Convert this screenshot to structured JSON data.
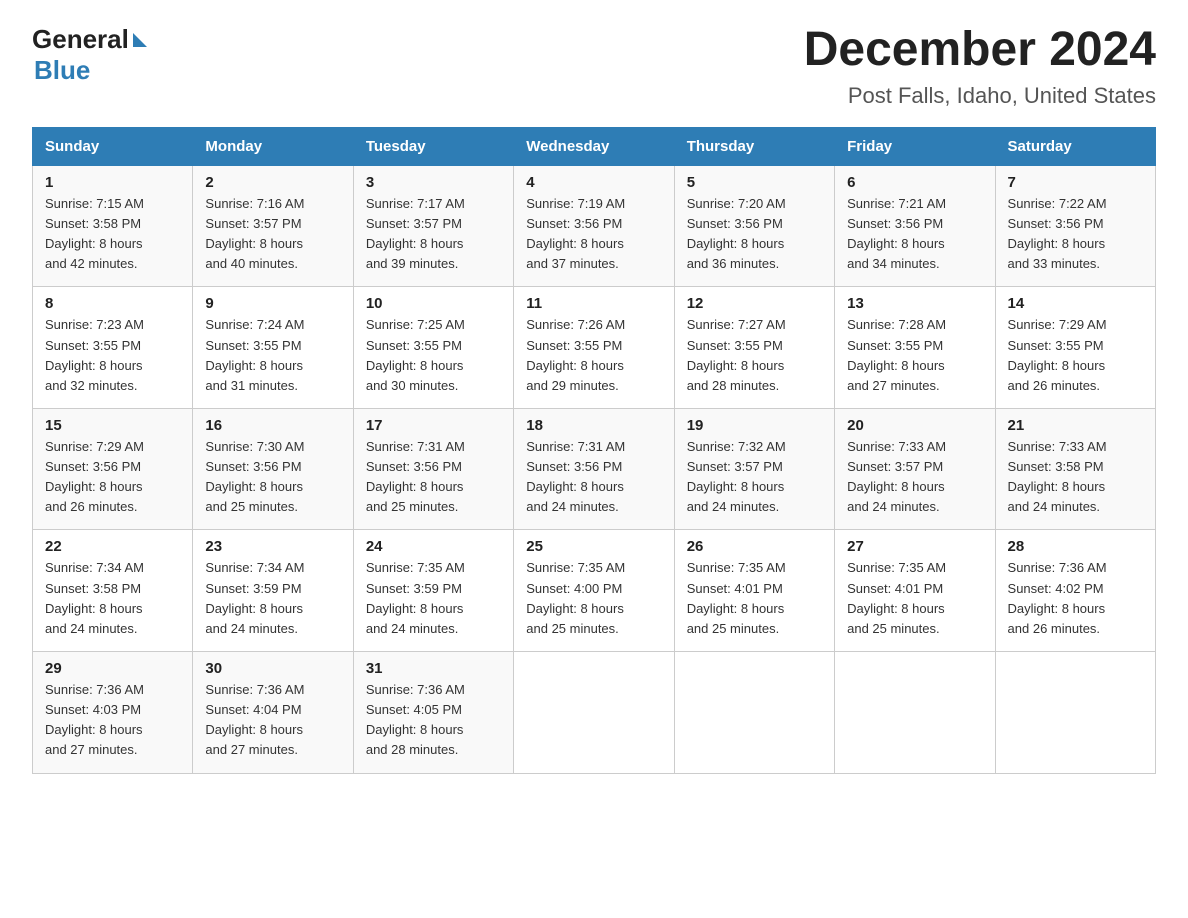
{
  "header": {
    "logo_line1": "General",
    "logo_line2": "Blue",
    "title": "December 2024",
    "subtitle": "Post Falls, Idaho, United States"
  },
  "calendar": {
    "days_of_week": [
      "Sunday",
      "Monday",
      "Tuesday",
      "Wednesday",
      "Thursday",
      "Friday",
      "Saturday"
    ],
    "weeks": [
      [
        {
          "date": "1",
          "sunrise": "7:15 AM",
          "sunset": "3:58 PM",
          "daylight": "8 hours and 42 minutes."
        },
        {
          "date": "2",
          "sunrise": "7:16 AM",
          "sunset": "3:57 PM",
          "daylight": "8 hours and 40 minutes."
        },
        {
          "date": "3",
          "sunrise": "7:17 AM",
          "sunset": "3:57 PM",
          "daylight": "8 hours and 39 minutes."
        },
        {
          "date": "4",
          "sunrise": "7:19 AM",
          "sunset": "3:56 PM",
          "daylight": "8 hours and 37 minutes."
        },
        {
          "date": "5",
          "sunrise": "7:20 AM",
          "sunset": "3:56 PM",
          "daylight": "8 hours and 36 minutes."
        },
        {
          "date": "6",
          "sunrise": "7:21 AM",
          "sunset": "3:56 PM",
          "daylight": "8 hours and 34 minutes."
        },
        {
          "date": "7",
          "sunrise": "7:22 AM",
          "sunset": "3:56 PM",
          "daylight": "8 hours and 33 minutes."
        }
      ],
      [
        {
          "date": "8",
          "sunrise": "7:23 AM",
          "sunset": "3:55 PM",
          "daylight": "8 hours and 32 minutes."
        },
        {
          "date": "9",
          "sunrise": "7:24 AM",
          "sunset": "3:55 PM",
          "daylight": "8 hours and 31 minutes."
        },
        {
          "date": "10",
          "sunrise": "7:25 AM",
          "sunset": "3:55 PM",
          "daylight": "8 hours and 30 minutes."
        },
        {
          "date": "11",
          "sunrise": "7:26 AM",
          "sunset": "3:55 PM",
          "daylight": "8 hours and 29 minutes."
        },
        {
          "date": "12",
          "sunrise": "7:27 AM",
          "sunset": "3:55 PM",
          "daylight": "8 hours and 28 minutes."
        },
        {
          "date": "13",
          "sunrise": "7:28 AM",
          "sunset": "3:55 PM",
          "daylight": "8 hours and 27 minutes."
        },
        {
          "date": "14",
          "sunrise": "7:29 AM",
          "sunset": "3:55 PM",
          "daylight": "8 hours and 26 minutes."
        }
      ],
      [
        {
          "date": "15",
          "sunrise": "7:29 AM",
          "sunset": "3:56 PM",
          "daylight": "8 hours and 26 minutes."
        },
        {
          "date": "16",
          "sunrise": "7:30 AM",
          "sunset": "3:56 PM",
          "daylight": "8 hours and 25 minutes."
        },
        {
          "date": "17",
          "sunrise": "7:31 AM",
          "sunset": "3:56 PM",
          "daylight": "8 hours and 25 minutes."
        },
        {
          "date": "18",
          "sunrise": "7:31 AM",
          "sunset": "3:56 PM",
          "daylight": "8 hours and 24 minutes."
        },
        {
          "date": "19",
          "sunrise": "7:32 AM",
          "sunset": "3:57 PM",
          "daylight": "8 hours and 24 minutes."
        },
        {
          "date": "20",
          "sunrise": "7:33 AM",
          "sunset": "3:57 PM",
          "daylight": "8 hours and 24 minutes."
        },
        {
          "date": "21",
          "sunrise": "7:33 AM",
          "sunset": "3:58 PM",
          "daylight": "8 hours and 24 minutes."
        }
      ],
      [
        {
          "date": "22",
          "sunrise": "7:34 AM",
          "sunset": "3:58 PM",
          "daylight": "8 hours and 24 minutes."
        },
        {
          "date": "23",
          "sunrise": "7:34 AM",
          "sunset": "3:59 PM",
          "daylight": "8 hours and 24 minutes."
        },
        {
          "date": "24",
          "sunrise": "7:35 AM",
          "sunset": "3:59 PM",
          "daylight": "8 hours and 24 minutes."
        },
        {
          "date": "25",
          "sunrise": "7:35 AM",
          "sunset": "4:00 PM",
          "daylight": "8 hours and 25 minutes."
        },
        {
          "date": "26",
          "sunrise": "7:35 AM",
          "sunset": "4:01 PM",
          "daylight": "8 hours and 25 minutes."
        },
        {
          "date": "27",
          "sunrise": "7:35 AM",
          "sunset": "4:01 PM",
          "daylight": "8 hours and 25 minutes."
        },
        {
          "date": "28",
          "sunrise": "7:36 AM",
          "sunset": "4:02 PM",
          "daylight": "8 hours and 26 minutes."
        }
      ],
      [
        {
          "date": "29",
          "sunrise": "7:36 AM",
          "sunset": "4:03 PM",
          "daylight": "8 hours and 27 minutes."
        },
        {
          "date": "30",
          "sunrise": "7:36 AM",
          "sunset": "4:04 PM",
          "daylight": "8 hours and 27 minutes."
        },
        {
          "date": "31",
          "sunrise": "7:36 AM",
          "sunset": "4:05 PM",
          "daylight": "8 hours and 28 minutes."
        },
        null,
        null,
        null,
        null
      ]
    ]
  },
  "labels": {
    "sunrise_label": "Sunrise:",
    "sunset_label": "Sunset:",
    "daylight_label": "Daylight:"
  }
}
